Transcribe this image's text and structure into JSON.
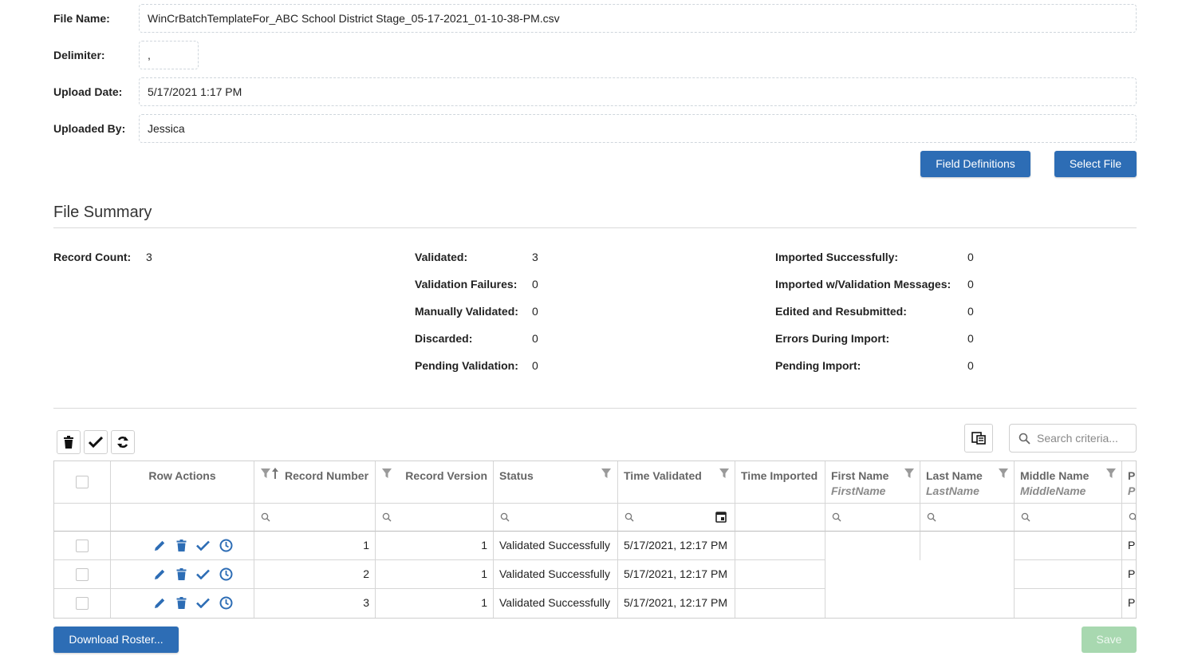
{
  "form": {
    "file_name_label": "File Name:",
    "file_name_value": "WinCrBatchTemplateFor_ABC School District Stage_05-17-2021_01-10-38-PM.csv",
    "delimiter_label": "Delimiter:",
    "delimiter_value": ",",
    "upload_date_label": "Upload Date:",
    "upload_date_value": "5/17/2021 1:17 PM",
    "uploaded_by_label": "Uploaded By:",
    "uploaded_by_value": "Jessica"
  },
  "buttons": {
    "field_definitions": "Field Definitions",
    "select_file": "Select File",
    "download_roster": "Download Roster...",
    "save": "Save"
  },
  "summary": {
    "title": "File Summary",
    "record_count_label": "Record Count:",
    "record_count_value": "3",
    "col2": [
      {
        "label": "Validated:",
        "value": "3"
      },
      {
        "label": "Validation Failures:",
        "value": "0"
      },
      {
        "label": "Manually Validated:",
        "value": "0"
      },
      {
        "label": "Discarded:",
        "value": "0"
      },
      {
        "label": "Pending Validation:",
        "value": "0"
      }
    ],
    "col3": [
      {
        "label": "Imported Successfully:",
        "value": "0"
      },
      {
        "label": "Imported w/Validation Messages:",
        "value": "0"
      },
      {
        "label": "Edited and Resubmitted:",
        "value": "0"
      },
      {
        "label": "Errors During Import:",
        "value": "0"
      },
      {
        "label": "Pending Import:",
        "value": "0"
      }
    ]
  },
  "toolbar": {
    "search_placeholder": "Search criteria..."
  },
  "grid": {
    "columns": [
      {
        "label": "Row Actions",
        "sub": ""
      },
      {
        "label": "Record Number",
        "sub": ""
      },
      {
        "label": "Record Version",
        "sub": ""
      },
      {
        "label": "Status",
        "sub": ""
      },
      {
        "label": "Time Validated",
        "sub": ""
      },
      {
        "label": "Time Imported",
        "sub": ""
      },
      {
        "label": "First Name",
        "sub": "FirstName"
      },
      {
        "label": "Last Name",
        "sub": "LastName"
      },
      {
        "label": "Middle Name",
        "sub": "MiddleName"
      },
      {
        "label": "P",
        "sub": "P"
      }
    ],
    "rows": [
      {
        "record_number": "1",
        "record_version": "1",
        "status": "Validated Successfully",
        "time_validated": "5/17/2021, 12:17 PM",
        "time_imported": "",
        "first_name": "",
        "last_name": "",
        "middle_name": "",
        "p": "P"
      },
      {
        "record_number": "2",
        "record_version": "1",
        "status": "Validated Successfully",
        "time_validated": "5/17/2021, 12:17 PM",
        "time_imported": "",
        "first_name": "",
        "last_name": "",
        "middle_name": "",
        "p": "P"
      },
      {
        "record_number": "3",
        "record_version": "1",
        "status": "Validated Successfully",
        "time_validated": "5/17/2021, 12:17 PM",
        "time_imported": "",
        "first_name": "",
        "last_name": "",
        "middle_name": "",
        "p": "P"
      }
    ]
  },
  "colors": {
    "primary": "#2d6db5",
    "save_disabled": "#a8d8b0"
  }
}
